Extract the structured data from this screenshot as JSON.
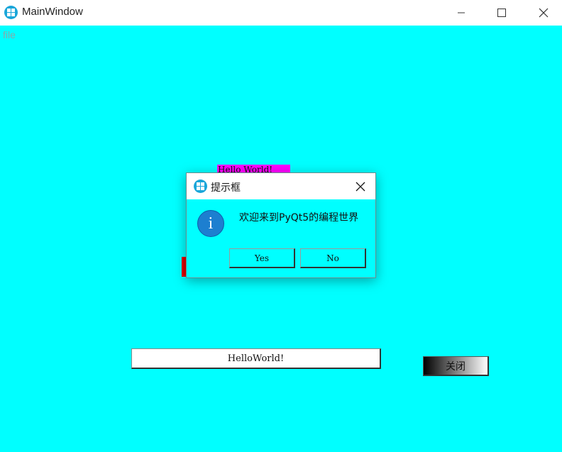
{
  "window": {
    "title": "MainWindow",
    "menu_file": "file"
  },
  "main": {
    "label_text": "Hello World!",
    "input_value": "HelloWorld!",
    "close_button": "关闭"
  },
  "dialog": {
    "title": "提示框",
    "message": "欢迎来到PyQt5的编程世界",
    "yes_label": "Yes",
    "no_label": "No",
    "icon": "info-icon"
  },
  "colors": {
    "background": "#00ffff",
    "label_background": "#ff00ff",
    "red_block": "#e00000",
    "accent": "#1aa6d9"
  }
}
